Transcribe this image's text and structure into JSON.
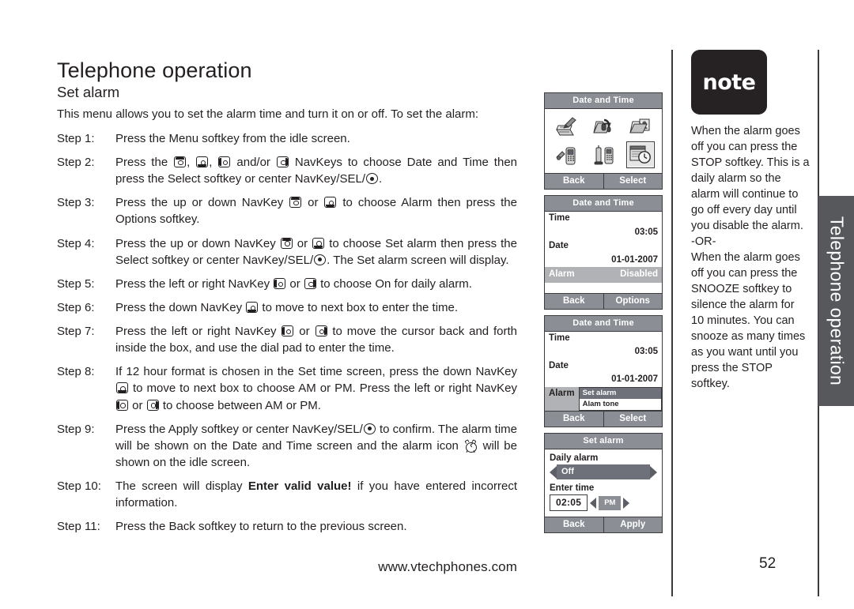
{
  "document": {
    "chapter_title": "Telephone operation",
    "section_title": "Set alarm",
    "intro": "This menu allows you to set the alarm time and turn it on or off. To set the alarm:",
    "footer_url": "www.vtechphones.com",
    "page_number": "52",
    "side_tab_label": "Telephone operation"
  },
  "steps": [
    {
      "label": "Step 1:",
      "parts": [
        {
          "t": "text",
          "v": "Press the Menu softkey from the idle screen."
        }
      ]
    },
    {
      "label": "Step  2:",
      "parts": [
        {
          "t": "text",
          "v": "Press the "
        },
        {
          "t": "navkey",
          "v": "up"
        },
        {
          "t": "text",
          "v": ", "
        },
        {
          "t": "navkey",
          "v": "down"
        },
        {
          "t": "text",
          "v": ", "
        },
        {
          "t": "navkey",
          "v": "left"
        },
        {
          "t": "text",
          "v": " and/or "
        },
        {
          "t": "navkey",
          "v": "right"
        },
        {
          "t": "text",
          "v": " NavKeys to choose Date and Time then press the Select softkey or center NavKey/SEL/"
        },
        {
          "t": "navkey",
          "v": "sel"
        },
        {
          "t": "text",
          "v": "."
        }
      ]
    },
    {
      "label": "Step 3:",
      "parts": [
        {
          "t": "text",
          "v": "Press the up or down NavKey "
        },
        {
          "t": "navkey",
          "v": "up"
        },
        {
          "t": "text",
          "v": " or "
        },
        {
          "t": "navkey",
          "v": "down"
        },
        {
          "t": "text",
          "v": " to choose Alarm then press the Options softkey."
        }
      ]
    },
    {
      "label": "Step 4:",
      "parts": [
        {
          "t": "text",
          "v": "Press the up or down NavKey "
        },
        {
          "t": "navkey",
          "v": "up"
        },
        {
          "t": "text",
          "v": " or "
        },
        {
          "t": "navkey",
          "v": "down"
        },
        {
          "t": "text",
          "v": " to choose Set alarm then press the Select softkey or center NavKey/SEL/"
        },
        {
          "t": "navkey",
          "v": "sel"
        },
        {
          "t": "text",
          "v": ". The Set alarm screen will display."
        }
      ]
    },
    {
      "label": "Step 5:",
      "parts": [
        {
          "t": "text",
          "v": "Press the left or right NavKey "
        },
        {
          "t": "navkey",
          "v": "left"
        },
        {
          "t": "text",
          "v": " or "
        },
        {
          "t": "navkey",
          "v": "right"
        },
        {
          "t": "text",
          "v": " to choose On for daily alarm."
        }
      ]
    },
    {
      "label": "Step 6:",
      "parts": [
        {
          "t": "text",
          "v": "Press the down NavKey "
        },
        {
          "t": "navkey",
          "v": "down"
        },
        {
          "t": "text",
          "v": " to move to next box to enter the time."
        }
      ]
    },
    {
      "label": "Step 7:",
      "parts": [
        {
          "t": "text",
          "v": "Press the left or right NavKey "
        },
        {
          "t": "navkey",
          "v": "left"
        },
        {
          "t": "text",
          "v": " or "
        },
        {
          "t": "navkey",
          "v": "right"
        },
        {
          "t": "text",
          "v": " to move the cursor back and forth inside the box, and use the dial pad to enter the time."
        }
      ]
    },
    {
      "label": "Step 8:",
      "parts": [
        {
          "t": "text",
          "v": "If 12 hour format is chosen in the Set time screen, press the down NavKey "
        },
        {
          "t": "navkey",
          "v": "down"
        },
        {
          "t": "text",
          "v": " to move to next box to choose AM or PM. Press the left or right NavKey "
        },
        {
          "t": "navkey",
          "v": "left"
        },
        {
          "t": "text",
          "v": " or "
        },
        {
          "t": "navkey",
          "v": "right"
        },
        {
          "t": "text",
          "v": " to choose between AM or PM."
        }
      ]
    },
    {
      "label": "Step 9:",
      "parts": [
        {
          "t": "text",
          "v": "Press the Apply softkey or center NavKey/SEL/"
        },
        {
          "t": "navkey",
          "v": "sel"
        },
        {
          "t": "text",
          "v": " to confirm. The alarm time will be shown on the Date and Time screen and the alarm icon "
        },
        {
          "t": "alarm",
          "v": "alarm-clock"
        },
        {
          "t": "text",
          "v": " will be shown on the idle screen."
        }
      ]
    },
    {
      "label": "Step 10:",
      "parts": [
        {
          "t": "text",
          "v": "The screen will display "
        },
        {
          "t": "bold",
          "v": "Enter valid value!"
        },
        {
          "t": "text",
          "v": " if you have entered incorrect information."
        }
      ]
    },
    {
      "label": "Step 11:",
      "parts": [
        {
          "t": "text",
          "v": "Press the Back softkey to return to the previous screen."
        }
      ]
    }
  ],
  "screens": [
    {
      "id": "menu-grid",
      "title": "Date and Time",
      "icons": [
        {
          "name": "message-pen-icon",
          "selected": false
        },
        {
          "name": "folder-headset-icon",
          "selected": false
        },
        {
          "name": "folder-contacts-icon",
          "selected": false
        },
        {
          "name": "handset-settings-icon",
          "selected": false
        },
        {
          "name": "base-handset-icon",
          "selected": false
        },
        {
          "name": "date-time-clock-icon",
          "selected": true
        }
      ],
      "softkeys": [
        "Back",
        "Select"
      ]
    },
    {
      "id": "date-time-list",
      "title": "Date and Time",
      "rows": [
        {
          "label": "Time",
          "value": "",
          "highlight": false
        },
        {
          "label": "",
          "value": "03:05",
          "highlight": false
        },
        {
          "label": "Date",
          "value": "",
          "highlight": false
        },
        {
          "label": "",
          "value": "01-01-2007",
          "highlight": false
        },
        {
          "label": "Alarm",
          "value": "Disabled",
          "highlight": true
        }
      ],
      "softkeys": [
        "Back",
        "Options"
      ]
    },
    {
      "id": "alarm-submenu",
      "title": "Date and Time",
      "rows": [
        {
          "label": "Time",
          "value": "",
          "highlight": false
        },
        {
          "label": "",
          "value": "03:05",
          "highlight": false
        },
        {
          "label": "Date",
          "value": "",
          "highlight": false
        },
        {
          "label": "",
          "value": "01-01-2007",
          "highlight": false
        }
      ],
      "submenu_label": "Alarm",
      "submenu_items": [
        {
          "label": "Set alarm",
          "selected": true
        },
        {
          "label": "Alam tone",
          "selected": false
        }
      ],
      "softkeys": [
        "Back",
        "Select"
      ]
    },
    {
      "id": "set-alarm",
      "title": "Set alarm",
      "daily_alarm_label": "Daily alarm",
      "daily_alarm_value": "Off",
      "enter_time_label": "Enter time",
      "enter_time_value": "02:05",
      "ampm_value": "PM",
      "softkeys": [
        "Back",
        "Apply"
      ]
    }
  ],
  "note": {
    "badge_label": "note",
    "paragraphs": [
      "When the alarm goes off you can press the STOP softkey. This is a daily alarm so the alarm will continue to go off every day until you disable the alarm.",
      "-OR-",
      "When the alarm goes off you can press the SNOOZE softkey to silence the alarm for 10 minutes. You can snooze as many times as you want until you press the STOP softkey."
    ]
  },
  "colors": {
    "ink": "#231f20",
    "screen_header": "#8b8e95",
    "screen_highlight": "#b0b2b6",
    "screen_selected": "#6e7179",
    "side_tab": "#56585c",
    "note_badge": "#262223"
  }
}
